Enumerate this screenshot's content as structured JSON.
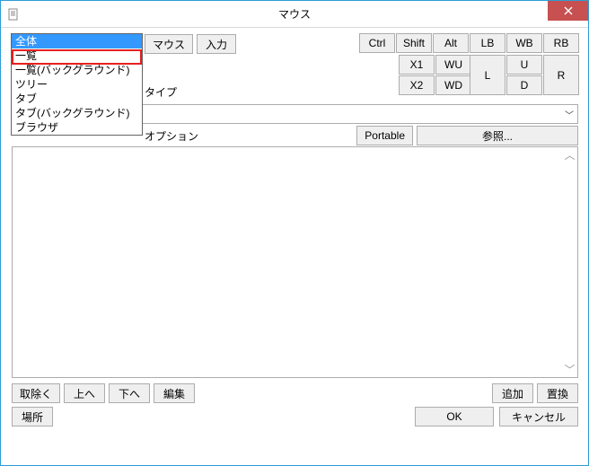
{
  "window": {
    "title": "マウス"
  },
  "dropdown": {
    "items": [
      {
        "label": "全体",
        "selected": true
      },
      {
        "label": "一覧"
      },
      {
        "label": "一覧(バックグラウンド)"
      },
      {
        "label": "ツリー"
      },
      {
        "label": "タブ"
      },
      {
        "label": "タブ(バックグラウンド)"
      },
      {
        "label": "ブラウザ"
      }
    ]
  },
  "toprow": {
    "mouse": "マウス",
    "input": "入力"
  },
  "mods": {
    "ctrl": "Ctrl",
    "shift": "Shift",
    "alt": "Alt",
    "lb": "LB",
    "wb": "WB",
    "rb": "RB",
    "x1": "X1",
    "wu": "WU",
    "l": "L",
    "u": "U",
    "r": "R",
    "x2": "X2",
    "wd": "WD",
    "d": "D"
  },
  "type": {
    "label": "タイプ"
  },
  "option": {
    "label": "オプション",
    "portable": "Portable",
    "browse": "参照..."
  },
  "actions": {
    "remove": "取除く",
    "up": "上へ",
    "down": "下へ",
    "edit": "編集",
    "add": "追加",
    "replace": "置換",
    "place": "場所"
  },
  "okcancel": {
    "ok": "OK",
    "cancel": "キャンセル"
  }
}
